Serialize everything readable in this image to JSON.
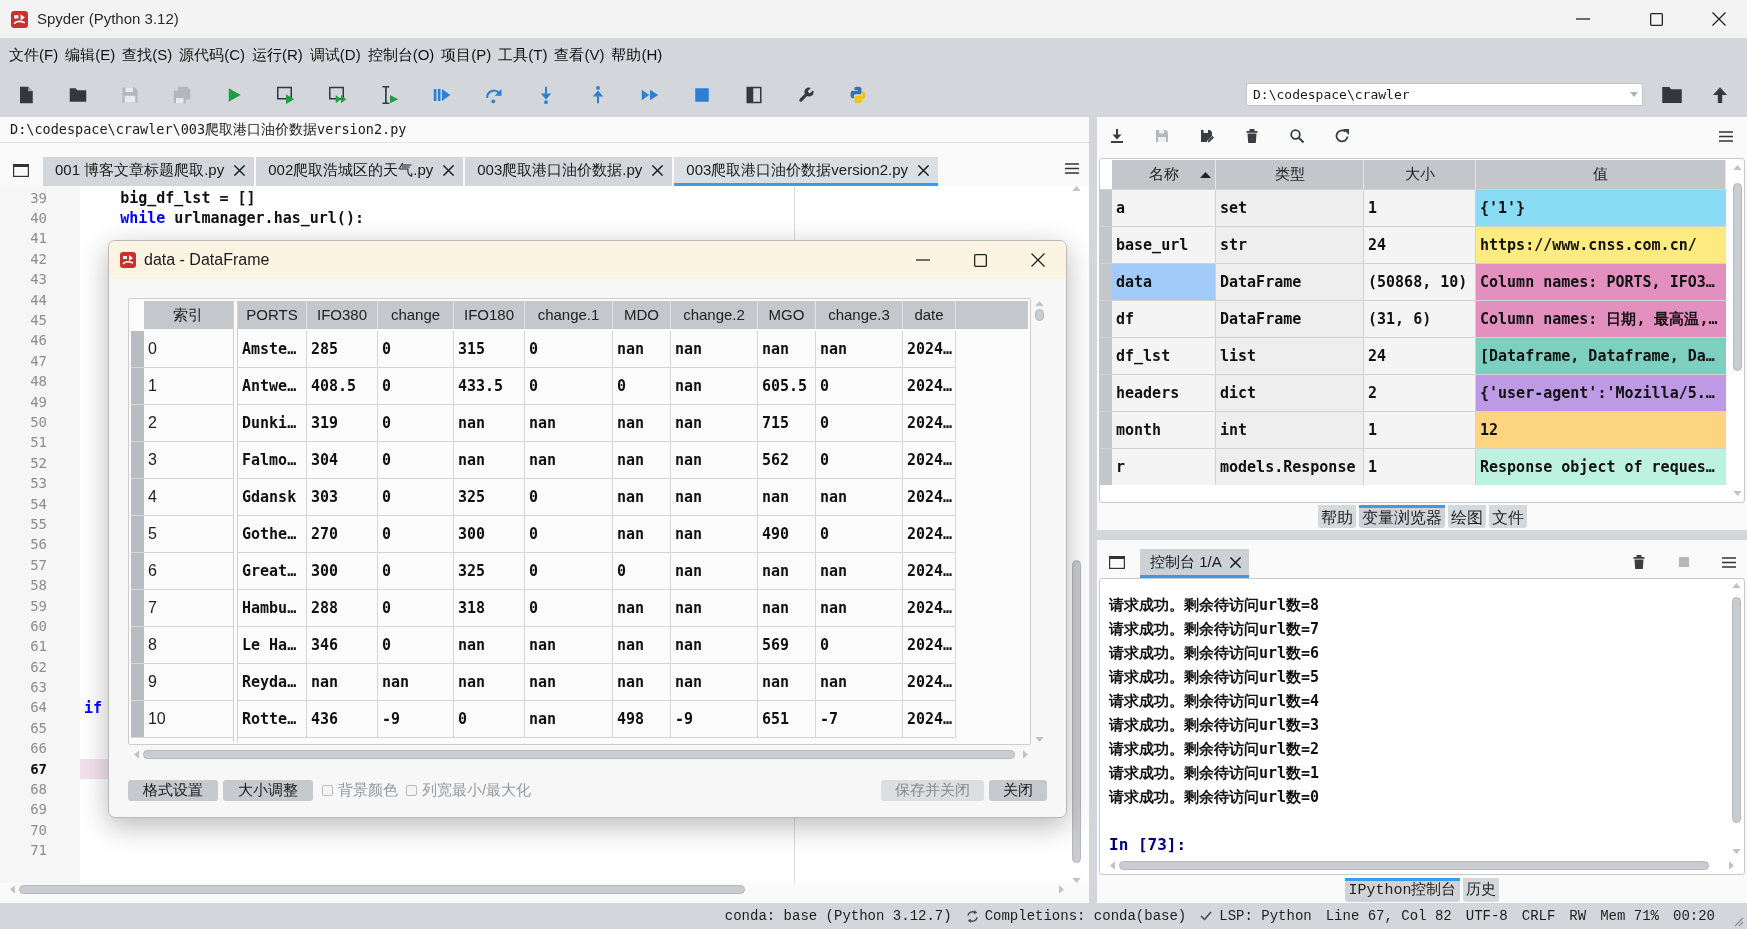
{
  "window": {
    "title": "Spyder (Python 3.12)"
  },
  "menu": [
    "文件(F)",
    "编辑(E)",
    "查找(S)",
    "源代码(C)",
    "运行(R)",
    "调试(D)",
    "控制台(O)",
    "项目(P)",
    "工具(T)",
    "查看(V)",
    "帮助(H)"
  ],
  "toolbar": {
    "buttons": [
      {
        "kind": "new",
        "disabled": false
      },
      {
        "kind": "open",
        "disabled": false
      },
      {
        "kind": "save",
        "disabled": true
      },
      {
        "kind": "saveall",
        "disabled": true
      },
      {
        "kind": "run",
        "disabled": false
      },
      {
        "kind": "runcell",
        "disabled": false
      },
      {
        "kind": "runnext",
        "disabled": false
      },
      {
        "kind": "runselection",
        "disabled": false
      },
      {
        "kind": "debug",
        "disabled": false
      },
      {
        "kind": "stepover",
        "disabled": false
      },
      {
        "kind": "stepinto",
        "disabled": false
      },
      {
        "kind": "stepout",
        "disabled": false
      },
      {
        "kind": "continue",
        "disabled": false
      },
      {
        "kind": "stop",
        "disabled": false
      },
      {
        "kind": "maximize",
        "disabled": false
      },
      {
        "kind": "preferences",
        "disabled": false
      },
      {
        "kind": "pythonpath",
        "disabled": false
      }
    ],
    "working_directory": "D:\\codespace\\crawler"
  },
  "editor": {
    "path": "D:\\codespace\\crawler\\003爬取港口油价数据version2.py",
    "tabs": [
      {
        "label": "001 博客文章标题爬取.py",
        "selected": false
      },
      {
        "label": "002爬取浩城区的天气.py",
        "selected": false
      },
      {
        "label": "003爬取港口油价数据.py",
        "selected": false
      },
      {
        "label": "003爬取港口油价数据version2.py",
        "selected": true
      }
    ],
    "lines": [
      {
        "number": "39",
        "current": false,
        "code": [
          {
            "kind": "plain",
            "text": "    big_df_lst = []"
          }
        ]
      },
      {
        "number": "40",
        "current": false,
        "code": [
          {
            "kind": "keyword",
            "text": "    while"
          },
          {
            "kind": "plain",
            "text": " urlmanager.has_url():"
          }
        ]
      },
      {
        "number": "41",
        "current": false
      },
      {
        "number": "42",
        "current": false
      },
      {
        "number": "43",
        "current": false
      },
      {
        "number": "44",
        "current": false
      },
      {
        "number": "45",
        "current": false
      },
      {
        "number": "46",
        "current": false
      },
      {
        "number": "47",
        "current": false
      },
      {
        "number": "48",
        "current": false
      },
      {
        "number": "49",
        "current": false
      },
      {
        "number": "50",
        "current": false
      },
      {
        "number": "51",
        "current": false
      },
      {
        "number": "52",
        "current": false
      },
      {
        "number": "53",
        "current": false
      },
      {
        "number": "54",
        "current": false
      },
      {
        "number": "55",
        "current": false
      },
      {
        "number": "56",
        "current": false
      },
      {
        "number": "57",
        "current": false
      },
      {
        "number": "58",
        "current": false
      },
      {
        "number": "59",
        "current": false
      },
      {
        "number": "60",
        "current": false
      },
      {
        "number": "61",
        "current": false
      },
      {
        "number": "62",
        "current": false
      },
      {
        "number": "63",
        "current": false
      },
      {
        "number": "64",
        "current": false,
        "code": [
          {
            "kind": "keyword",
            "text": "if"
          }
        ]
      },
      {
        "number": "65",
        "current": false
      },
      {
        "number": "66",
        "current": false
      },
      {
        "number": "67",
        "current": true
      },
      {
        "number": "68",
        "current": false
      },
      {
        "number": "69",
        "current": false
      },
      {
        "number": "70",
        "current": false
      },
      {
        "number": "71",
        "current": false
      }
    ]
  },
  "dataframe_editor": {
    "title": "data - DataFrame",
    "index_header": "索引",
    "columns": [
      "PORTS",
      "IFO380",
      "change",
      "IFO180",
      "change.1",
      "MDO",
      "change.2",
      "MGO",
      "change.3",
      "date"
    ],
    "rows": [
      {
        "index": "0",
        "cells": [
          "Amste…",
          "285",
          "0",
          "315",
          "0",
          "nan",
          "nan",
          "nan",
          "nan",
          "2024…"
        ]
      },
      {
        "index": "1",
        "cells": [
          "Antwe…",
          "408.5",
          "0",
          "433.5",
          "0",
          "0",
          "nan",
          "605.5",
          "0",
          "2024…"
        ]
      },
      {
        "index": "2",
        "cells": [
          "Dunki…",
          "319",
          "0",
          "nan",
          "nan",
          "nan",
          "nan",
          "715",
          "0",
          "2024…"
        ]
      },
      {
        "index": "3",
        "cells": [
          "Falmo…",
          "304",
          "0",
          "nan",
          "nan",
          "nan",
          "nan",
          "562",
          "0",
          "2024…"
        ]
      },
      {
        "index": "4",
        "cells": [
          "Gdansk",
          "303",
          "0",
          "325",
          "0",
          "nan",
          "nan",
          "nan",
          "nan",
          "2024…"
        ]
      },
      {
        "index": "5",
        "cells": [
          "Gothe…",
          "270",
          "0",
          "300",
          "0",
          "nan",
          "nan",
          "490",
          "0",
          "2024…"
        ]
      },
      {
        "index": "6",
        "cells": [
          "Great…",
          "300",
          "0",
          "325",
          "0",
          "0",
          "nan",
          "nan",
          "nan",
          "2024…"
        ]
      },
      {
        "index": "7",
        "cells": [
          "Hambu…",
          "288",
          "0",
          "318",
          "0",
          "nan",
          "nan",
          "nan",
          "nan",
          "2024…"
        ]
      },
      {
        "index": "8",
        "cells": [
          "Le Ha…",
          "346",
          "0",
          "nan",
          "nan",
          "nan",
          "nan",
          "569",
          "0",
          "2024…"
        ]
      },
      {
        "index": "9",
        "cells": [
          "Reyda…",
          "nan",
          "nan",
          "nan",
          "nan",
          "nan",
          "nan",
          "nan",
          "nan",
          "2024…"
        ]
      },
      {
        "index": "10",
        "cells": [
          "Rotte…",
          "436",
          "-9",
          "0",
          "nan",
          "498",
          "-9",
          "651",
          "-7",
          "2024…"
        ]
      }
    ],
    "buttons_left": [
      {
        "label": "格式设置",
        "disabled": false
      },
      {
        "label": "大小调整",
        "disabled": false
      }
    ],
    "options": [
      {
        "label": "背景颜色",
        "checked": false,
        "disabled": true
      },
      {
        "label": "列宽最小/最大化",
        "checked": false,
        "disabled": true
      }
    ],
    "buttons_right": [
      {
        "label": "保存并关闭",
        "disabled": true
      },
      {
        "label": "关闭",
        "disabled": false
      }
    ]
  },
  "variable_explorer": {
    "toolbar": [
      {
        "kind": "import",
        "disabled": false
      },
      {
        "kind": "save",
        "disabled": true
      },
      {
        "kind": "saveas",
        "disabled": false
      },
      {
        "kind": "remove",
        "disabled": false
      },
      {
        "kind": "search",
        "disabled": false
      },
      {
        "kind": "refresh",
        "disabled": false
      }
    ],
    "columns": [
      {
        "label": "名称",
        "sorted": true
      },
      {
        "label": "类型",
        "sorted": false
      },
      {
        "label": "大小",
        "sorted": false
      },
      {
        "label": "值",
        "sorted": false
      }
    ],
    "rows": [
      {
        "name": "a",
        "type": "set",
        "size": "1",
        "value": "{'1'}",
        "color": "#8adcf5",
        "selected": false
      },
      {
        "name": "base_url",
        "type": "str",
        "size": "24",
        "value": "https://www.cnss.com.cn/",
        "color": "#fdeb7f",
        "selected": false
      },
      {
        "name": "data",
        "type": "DataFrame",
        "size": "(50868, 10)",
        "value": "Column names: PORTS, IFO3…",
        "color": "#e38fbf",
        "selected": true
      },
      {
        "name": "df",
        "type": "DataFrame",
        "size": "(31, 6)",
        "value": "Column names: 日期, 最高温,…",
        "color": "#e38fbf",
        "selected": false
      },
      {
        "name": "df_lst",
        "type": "list",
        "size": "24",
        "value": "[Dataframe, Dataframe, Da…",
        "color": "#7dd0bf",
        "selected": false
      },
      {
        "name": "headers",
        "type": "dict",
        "size": "2",
        "value": "{'user-agent':'Mozilla/5.…",
        "color": "#be9ae5",
        "selected": false
      },
      {
        "name": "month",
        "type": "int",
        "size": "1",
        "value": "12",
        "color": "#fdd580",
        "selected": false
      },
      {
        "name": "r",
        "type": "models.Response",
        "size": "1",
        "value": "Response object of reques…",
        "color": "#bdf1e0",
        "selected": false
      }
    ],
    "pane_tabs": [
      {
        "label": "帮助",
        "selected": false
      },
      {
        "label": "变量浏览器",
        "selected": true
      },
      {
        "label": "绘图",
        "selected": false
      },
      {
        "label": "文件",
        "selected": false
      }
    ]
  },
  "console": {
    "toolbar": [
      {
        "kind": "remove",
        "disabled": false
      },
      {
        "kind": "stop",
        "disabled": true
      }
    ],
    "tabs": [
      {
        "label": "控制台 1/A",
        "selected": true
      }
    ],
    "output": [
      "请求成功。剩余待访问url数=8",
      "请求成功。剩余待访问url数=7",
      "请求成功。剩余待访问url数=6",
      "请求成功。剩余待访问url数=5",
      "请求成功。剩余待访问url数=4",
      "请求成功。剩余待访问url数=3",
      "请求成功。剩余待访问url数=2",
      "请求成功。剩余待访问url数=1",
      "请求成功。剩余待访问url数=0"
    ],
    "prompt": "In [73]:",
    "pane_tabs": [
      {
        "label": "IPython控制台",
        "selected": true
      },
      {
        "label": "历史",
        "selected": false
      }
    ]
  },
  "status_bar": {
    "items": [
      {
        "kind": "text",
        "text": "conda: base (Python 3.12.7)"
      },
      {
        "kind": "completions",
        "text": "Completions: conda(base)"
      },
      {
        "kind": "lsp",
        "text": "LSP: Python"
      },
      {
        "kind": "text",
        "text": "Line 67, Col 82"
      },
      {
        "kind": "text",
        "text": "UTF-8"
      },
      {
        "kind": "text",
        "text": "CRLF"
      },
      {
        "kind": "text",
        "text": "RW"
      },
      {
        "kind": "text",
        "text": "Mem 71%"
      },
      {
        "kind": "text",
        "text": "00:20"
      }
    ]
  }
}
